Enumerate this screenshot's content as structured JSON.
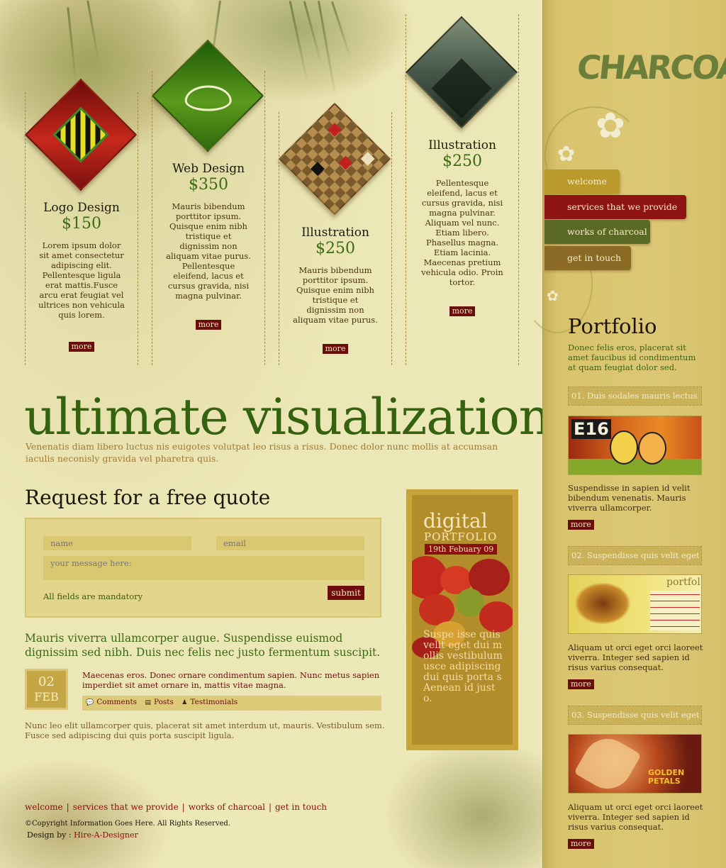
{
  "services": [
    {
      "title": "Logo Design",
      "price": "$150",
      "text": "Lorem ipsum dolor sit amet consectetur adipiscing elit. Pellentesque ligula erat mattis.Fusce arcu erat feugiat vel ultrices non vehicula quis lorem.",
      "more": "more",
      "colors": [
        "#8c1010",
        "#d22a1c"
      ]
    },
    {
      "title": "Web Design",
      "price": "$350",
      "text": "Mauris bibendum porttitor ipsum. Quisque enim nibh tristique et dignissim non aliquam vitae purus. Pellentesque eleifend, lacus et cursus gravida, nisi magna pulvinar.",
      "more": "more",
      "colors": [
        "#2f6a10",
        "#5c9a22"
      ]
    },
    {
      "title": "Illustration",
      "price": "$250",
      "text": "Mauris bibendum porttitor ipsum. Quisque enim nibh tristique et dignissim non aliquam vitae purus.",
      "more": "more",
      "colors": [
        "#8a6a2a",
        "#b08d4a"
      ]
    },
    {
      "title": "Illustration",
      "price": "$250",
      "text": "Pellentesque eleifend, lacus et cursus gravida, nisi magna pulvinar. Aliquam vel nunc. Etiam libero. Phasellus magna. Etiam lacinia. Maecenas pretium vehicula odio. Proin tortor.",
      "more": "more",
      "colors": [
        "#3a4a3a",
        "#7c8a6c"
      ]
    }
  ],
  "headline": "ultimate visualization",
  "subhead": "Venenatis diam libero luctus nis euigotes volutpat leo risus a risus. Donec dolor nunc mollis at accumsan iaculis neconisly gravida vel pharetra quis.",
  "quote": {
    "title": "Request for a free quote",
    "name_placeholder": "name",
    "email_placeholder": "email",
    "message_placeholder": "your message here:",
    "mandatory": "All fields are mandatory",
    "submit": "submit"
  },
  "news": {
    "lead": "Mauris viverra ullamcorper augue. Suspendisse euismod dignissim sed nibh. Duis nec felis nec justo fermentum suscipit.",
    "day": "02",
    "month": "FEB",
    "text": "Maecenas eros. Donec ornare condimentum sapien. Nunc metus sapien imperdiet sit amet ornare in, mattis vitae magna.",
    "links": [
      "Comments",
      "Posts",
      "Testimonials"
    ],
    "footer": "Nunc leo elit ullamcorper quis, placerat sit amet interdum ut, mauris. Vestibulum sem. Fusce sed adipiscing dui quis porta suscipit ligula."
  },
  "digital_portfolio": {
    "word1": "digital",
    "word2": "PORTFOLIO",
    "date": "19th Febuary 09",
    "text": "Suspe isse quis velit eget dui mollis vestibulum usce adipiscing dui quis porta s Aenean id justo."
  },
  "footer": {
    "links": [
      "welcome",
      "services that we provide",
      "works of charcoal",
      "get in touch"
    ],
    "copyright": "©Copyright Information Goes Here. All Rights Reserved.",
    "design_by_label": "Design by :",
    "design_by_link": "Hire-A-Designer"
  },
  "sidebar": {
    "logo": "CHARCOAL",
    "nav": [
      {
        "label": "welcome",
        "color": "#b99a2a"
      },
      {
        "label": "services that we provide",
        "color": "#8e1414"
      },
      {
        "label": "works of charcoal",
        "color": "#5a6a24"
      },
      {
        "label": "get in touch",
        "color": "#8a6a24"
      }
    ],
    "portfolio_title": "Portfolio",
    "portfolio_desc": "Donec felis eros, placerat sit amet faucibus id condimentum at quam feugiat dolor sed.",
    "items": [
      {
        "heading": "01. Duis sodales mauris lectus",
        "thumb_label": "E16",
        "text": "Suspendisse in sapien id velit bibendum venenatis. Mauris viverra ullamcorper.",
        "more": "more"
      },
      {
        "heading": "02. Suspendisse quis velit eget",
        "thumb_label": "portfol",
        "text": "Aliquam ut orci eget orci laoreet viverra. Integer sed sapien id risus varius consequat.",
        "more": "more"
      },
      {
        "heading": "03. Suspendisse quis velit eget",
        "thumb_label": "GOLDEN PETALS",
        "text": "Aliquam ut orci eget orci laoreet viverra. Integer sed sapien id risus varius consequat.",
        "more": "more"
      }
    ]
  }
}
